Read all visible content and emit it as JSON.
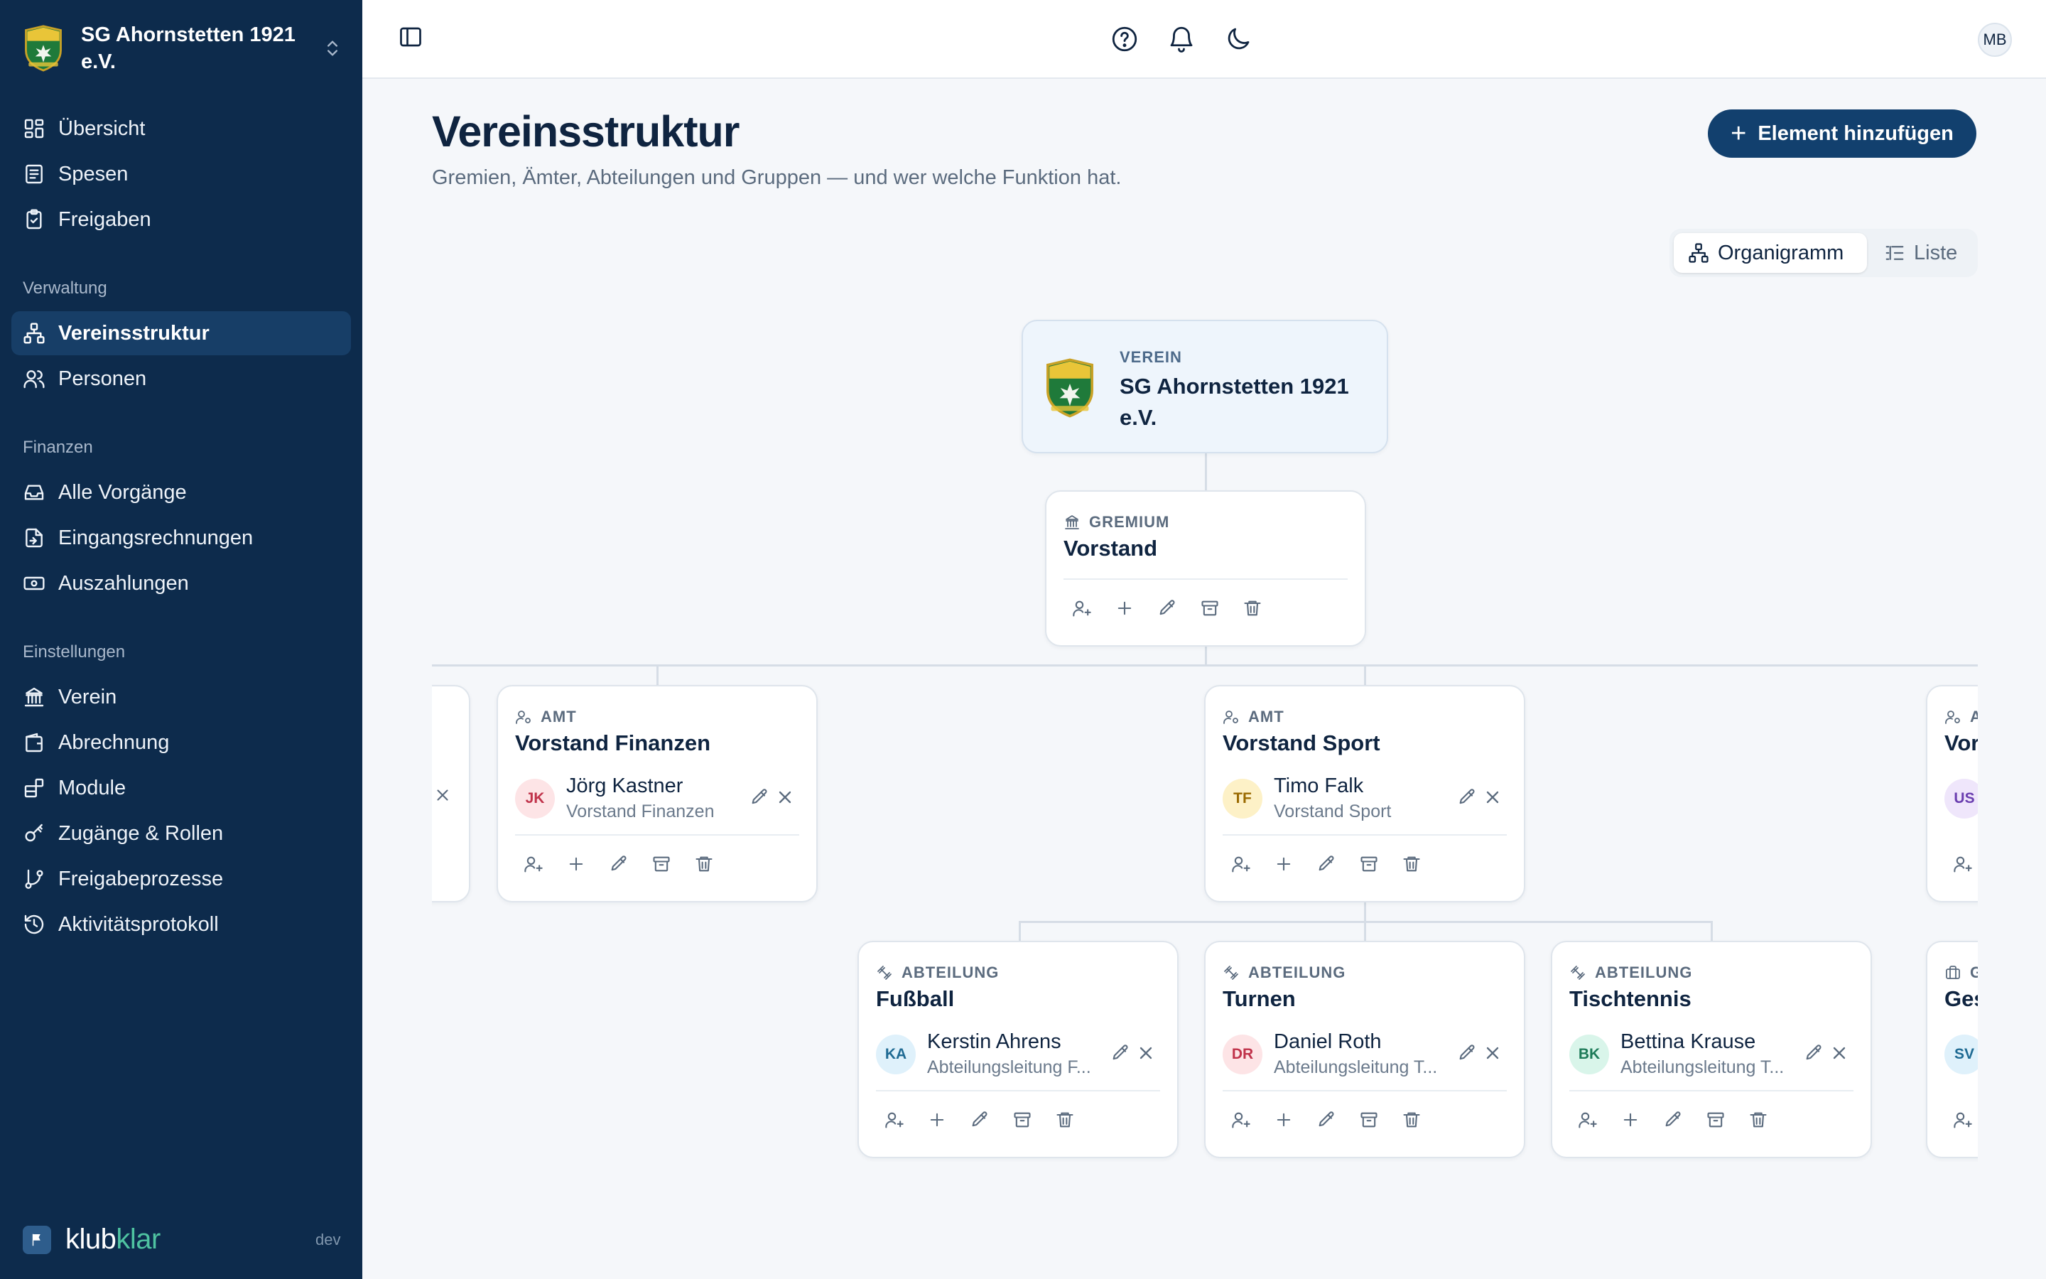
{
  "sidebar": {
    "org_name": "SG Ahornstetten 1921 e.V.",
    "items_main": [
      {
        "label": "Übersicht",
        "icon": "dashboard-icon"
      },
      {
        "label": "Spesen",
        "icon": "receipt-icon"
      },
      {
        "label": "Freigaben",
        "icon": "clipboard-check-icon"
      }
    ],
    "section_verwaltung": "Verwaltung",
    "items_verwaltung": [
      {
        "label": "Vereinsstruktur",
        "icon": "org-chart-icon",
        "active": true
      },
      {
        "label": "Personen",
        "icon": "users-icon"
      }
    ],
    "section_finanzen": "Finanzen",
    "items_finanzen": [
      {
        "label": "Alle Vorgänge",
        "icon": "inbox-icon"
      },
      {
        "label": "Eingangsrechnungen",
        "icon": "file-import-icon"
      },
      {
        "label": "Auszahlungen",
        "icon": "banknote-icon"
      }
    ],
    "section_einstellungen": "Einstellungen",
    "items_einstellungen": [
      {
        "label": "Verein",
        "icon": "building-icon"
      },
      {
        "label": "Abrechnung",
        "icon": "wallet-icon"
      },
      {
        "label": "Module",
        "icon": "blocks-icon"
      },
      {
        "label": "Zugänge & Rollen",
        "icon": "key-icon"
      },
      {
        "label": "Freigabeprozesse",
        "icon": "git-branch-icon"
      },
      {
        "label": "Aktivitätsprotokoll",
        "icon": "history-icon"
      }
    ],
    "footer_brand_a": "klub",
    "footer_brand_b": "klar",
    "env": "dev"
  },
  "topbar": {
    "avatar_initials": "MB"
  },
  "page": {
    "title": "Vereinsstruktur",
    "subtitle": "Gremien, Ämter, Abteilungen und Gruppen — und wer welche Funktion hat.",
    "add_button": "Element hinzufügen",
    "view_org": "Organigramm",
    "view_list": "Liste"
  },
  "org": {
    "root": {
      "type": "VEREIN",
      "name": "SG Ahornstetten 1921 e.V."
    },
    "vorstand": {
      "type": "GREMIUM",
      "name": "Vorstand"
    },
    "finanzen": {
      "type": "AMT",
      "name": "Vorstand Finanzen",
      "person": "Jörg Kastner",
      "role": "Vorstand Finanzen",
      "initials": "JK"
    },
    "sport": {
      "type": "AMT",
      "name": "Vorstand Sport",
      "person": "Timo Falk",
      "role": "Vorstand Sport",
      "initials": "TF"
    },
    "right_partial": {
      "type": "A",
      "name": "Vor",
      "initials": "US"
    },
    "fussball": {
      "type": "ABTEILUNG",
      "name": "Fußball",
      "person": "Kerstin Ahrens",
      "role": "Abteilungsleitung F...",
      "initials": "KA"
    },
    "turnen": {
      "type": "ABTEILUNG",
      "name": "Turnen",
      "person": "Daniel Roth",
      "role": "Abteilungsleitung T...",
      "initials": "DR"
    },
    "tischtennis": {
      "type": "ABTEILUNG",
      "name": "Tischtennis",
      "person": "Bettina Krause",
      "role": "Abteilungsleitung T...",
      "initials": "BK"
    },
    "right_partial2": {
      "type": "G",
      "name": "Ges",
      "initials": "SV"
    }
  },
  "colors": {
    "sidebar_bg": "#0d2b4c",
    "accent": "#12406e",
    "brand_green": "#4fc3a1"
  }
}
